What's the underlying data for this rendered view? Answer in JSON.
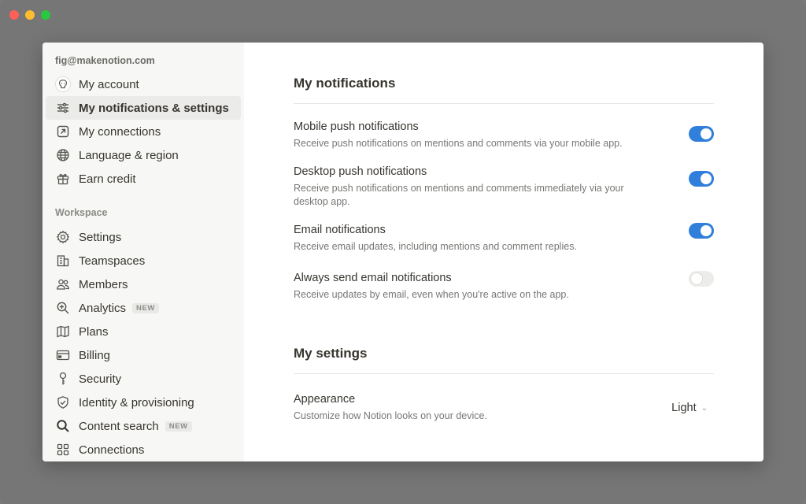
{
  "account": {
    "email": "fig@makenotion.com",
    "items": [
      {
        "label": "My account"
      },
      {
        "label": "My notifications & settings"
      },
      {
        "label": "My connections"
      },
      {
        "label": "Language & region"
      },
      {
        "label": "Earn credit"
      }
    ]
  },
  "workspace": {
    "label": "Workspace",
    "items": [
      {
        "label": "Settings"
      },
      {
        "label": "Teamspaces"
      },
      {
        "label": "Members"
      },
      {
        "label": "Analytics",
        "badge": "NEW"
      },
      {
        "label": "Plans"
      },
      {
        "label": "Billing"
      },
      {
        "label": "Security"
      },
      {
        "label": "Identity & provisioning"
      },
      {
        "label": "Content search",
        "badge": "NEW"
      },
      {
        "label": "Connections"
      }
    ]
  },
  "notifications": {
    "title": "My notifications",
    "rows": [
      {
        "title": "Mobile push notifications",
        "desc": "Receive push notifications on mentions and comments via your mobile app.",
        "enabled": true
      },
      {
        "title": "Desktop push notifications",
        "desc": "Receive push notifications on mentions and comments immediately via your desktop app.",
        "enabled": true
      },
      {
        "title": "Email notifications",
        "desc": "Receive email updates, including mentions and comment replies.",
        "enabled": true
      },
      {
        "title": "Always send email notifications",
        "desc": "Receive updates by email, even when you're active on the app.",
        "enabled": false
      }
    ]
  },
  "settings": {
    "title": "My settings",
    "appearance": {
      "title": "Appearance",
      "desc": "Customize how Notion looks on your device.",
      "value": "Light"
    }
  },
  "colors": {
    "accent": "#2f7fdb",
    "sidebar_bg": "#f7f7f5",
    "backdrop": "#767676"
  }
}
